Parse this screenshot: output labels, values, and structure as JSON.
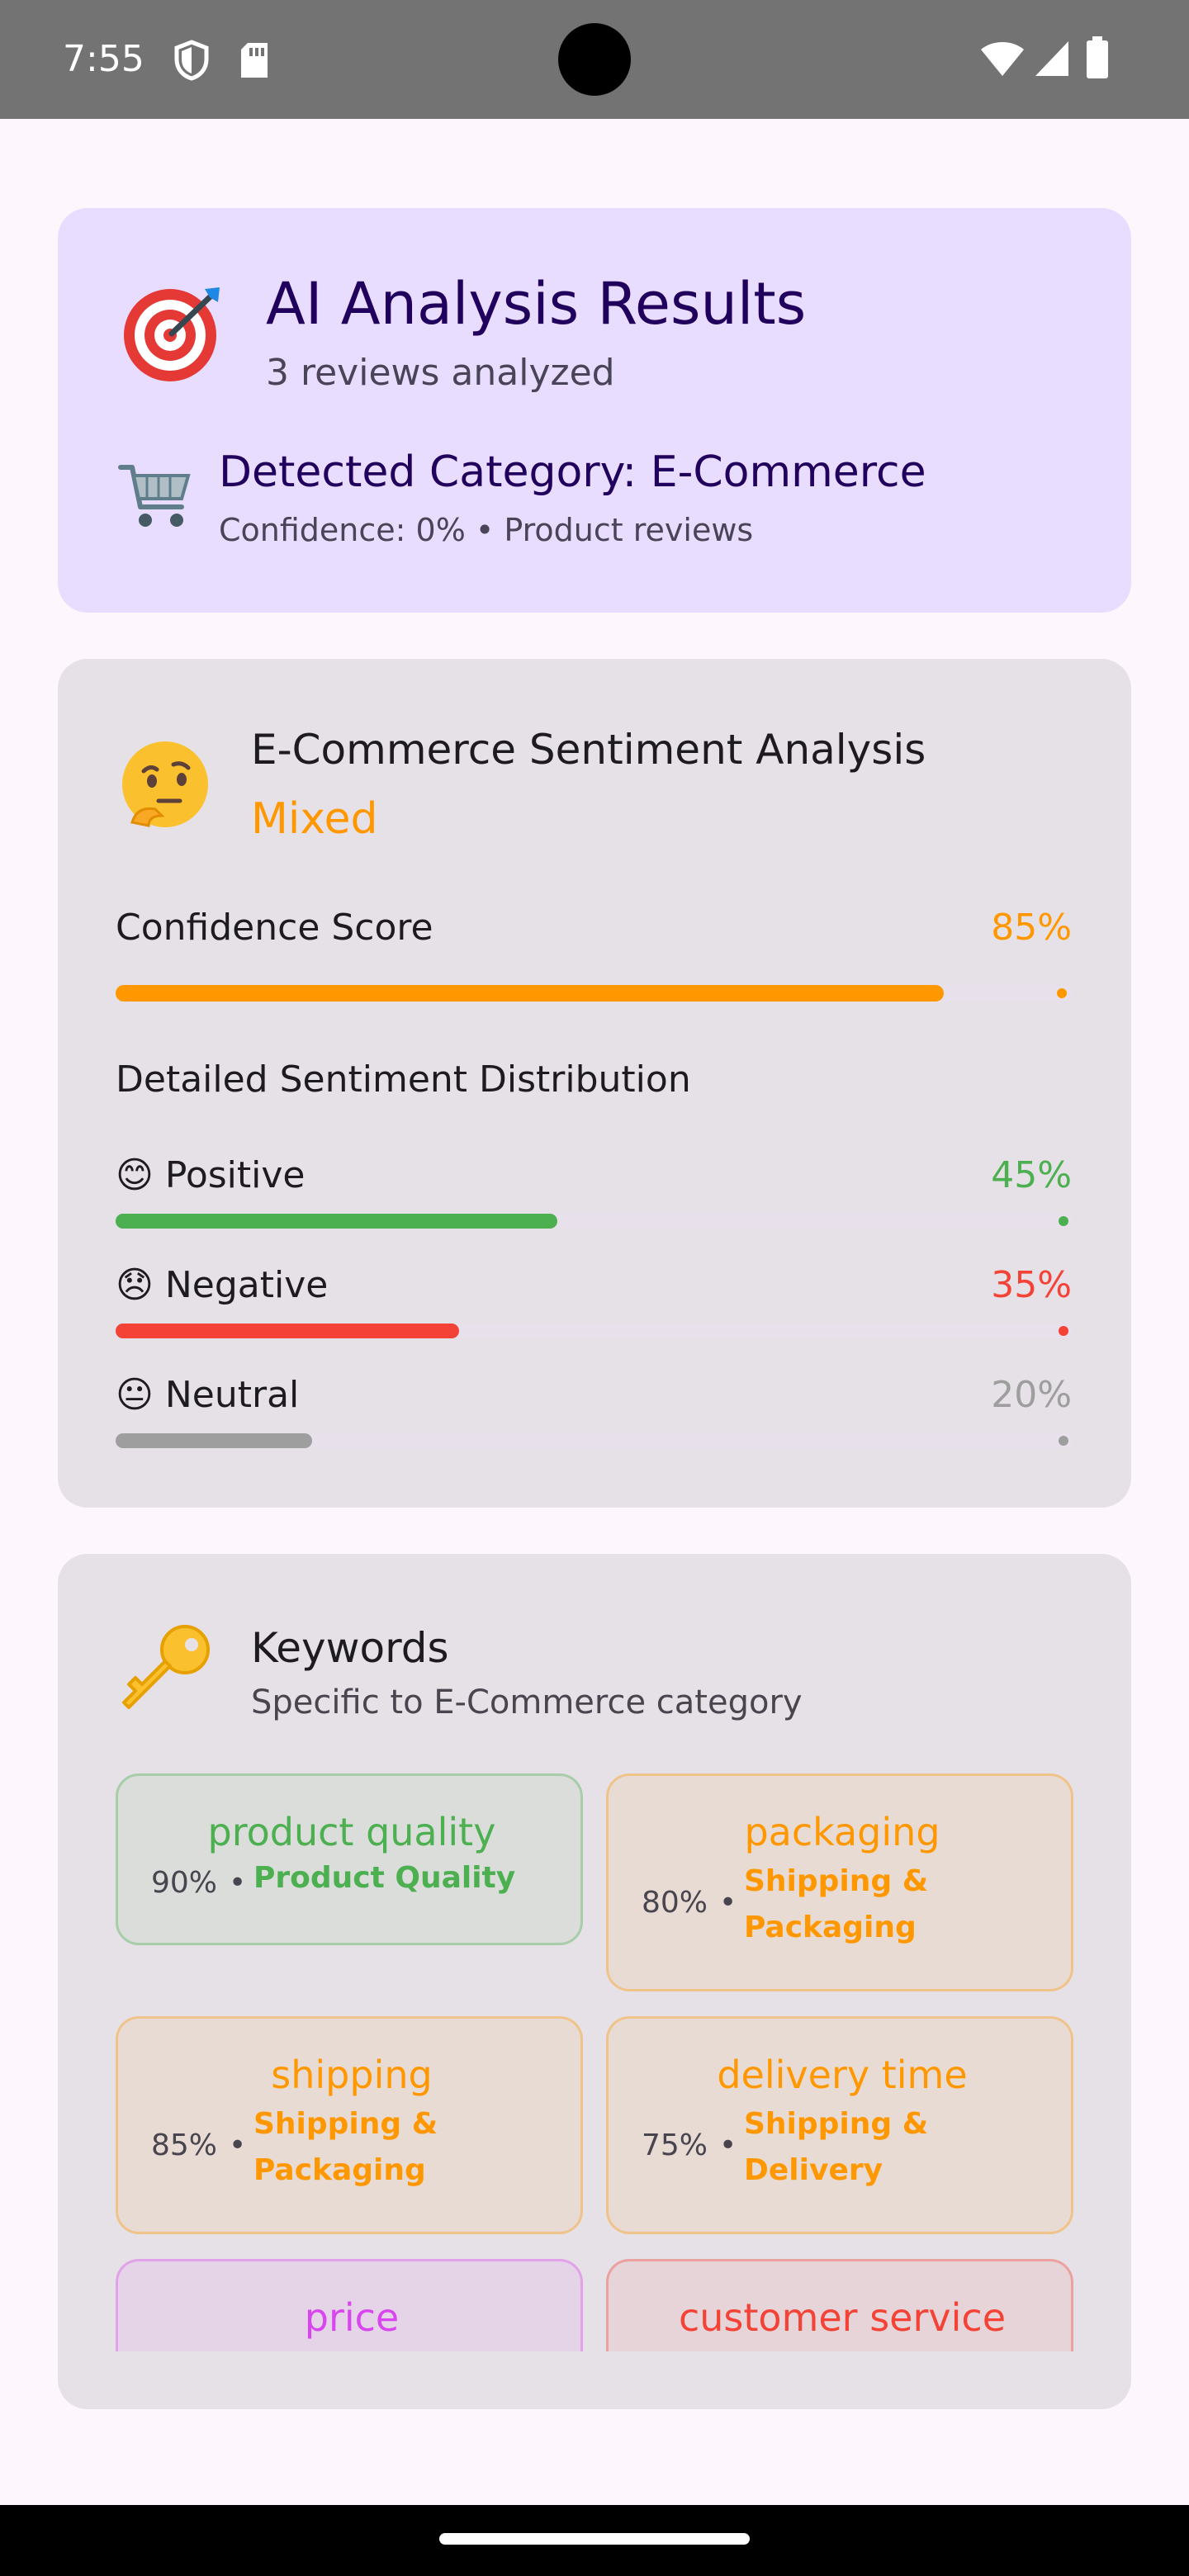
{
  "status_bar": {
    "time": "7:55",
    "icons": [
      "shield-icon",
      "sd-card-icon",
      "wifi-icon",
      "signal-icon",
      "battery-icon"
    ]
  },
  "analysis_card": {
    "icon": "🎯",
    "title": "AI Analysis Results",
    "subtitle": "3 reviews analyzed",
    "category_icon": "🛒",
    "category_title": "Detected Category: E-Commerce",
    "category_sub": "Confidence: 0% • Product reviews"
  },
  "sentiment_card": {
    "icon": "🤔",
    "title": "E-Commerce Sentiment Analysis",
    "overall": "Mixed",
    "confidence_label": "Confidence Score",
    "confidence_value": "85%",
    "confidence_fraction": 0.85,
    "distribution_title": "Detailed Sentiment Distribution",
    "rows": [
      {
        "emoji": "😊",
        "label": "Positive",
        "value": "45%",
        "fraction": 0.45,
        "color": "#4caf50"
      },
      {
        "emoji": "😞",
        "label": "Negative",
        "value": "35%",
        "fraction": 0.35,
        "color": "#f44336"
      },
      {
        "emoji": "😐",
        "label": "Neutral",
        "value": "20%",
        "fraction": 0.2,
        "color": "#9e9e9e"
      }
    ],
    "colors": {
      "confidence": "#ff9800"
    }
  },
  "keywords_card": {
    "icon": "🔑",
    "title": "Keywords",
    "subtitle": "Specific to E-Commerce category",
    "chips": [
      {
        "keyword": "product quality",
        "percent": "90%",
        "category_line1": "Product Quality",
        "category_line2": "",
        "color": "#4caf50"
      },
      {
        "keyword": "packaging",
        "percent": "80%",
        "category_line1": "Shipping &",
        "category_line2": "Packaging",
        "color": "#ff9800"
      },
      {
        "keyword": "shipping",
        "percent": "85%",
        "category_line1": "Shipping &",
        "category_line2": "Packaging",
        "color": "#ff9800"
      },
      {
        "keyword": "delivery time",
        "percent": "75%",
        "category_line1": "Shipping &",
        "category_line2": "Delivery",
        "color": "#ff9800"
      },
      {
        "keyword": "price",
        "color": "#d946ef"
      },
      {
        "keyword": "customer service",
        "color": "#f44336"
      }
    ]
  }
}
